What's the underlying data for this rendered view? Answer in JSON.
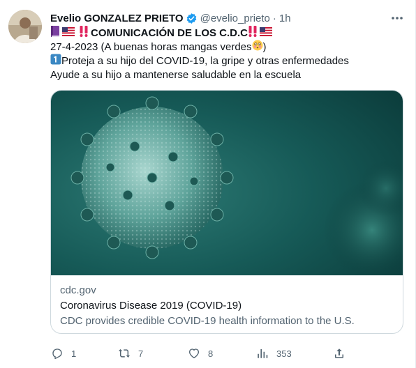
{
  "tweet": {
    "author_name": "Evelio GONZALEZ PRIETO",
    "author_handle": "@evelio_prieto",
    "separator": "·",
    "time": "1h",
    "lines": {
      "headline": "COMUNICACIÓN DE LOS C.D.C",
      "date_note": "27-4-2023 (A buenas horas mangas verdes",
      "date_close": ")",
      "item_one": "Proteja a su hijo del COVID-19, la gripe y otras enfermedades",
      "item_two": "Ayude a su hijo a mantenerse saludable en la escuela"
    },
    "emoji": {
      "book": "purple-book-icon",
      "flag": "us-flag-icon",
      "alert": "double-exclamation-icon",
      "face": "flushed-face-icon",
      "keycap": "keycap-1-icon"
    }
  },
  "card": {
    "image": "coronavirus-illustration",
    "domain": "cdc.gov",
    "title": "Coronavirus Disease 2019 (COVID-19)",
    "description": "CDC provides credible COVID-19 health information to the U.S."
  },
  "actions": {
    "reply_count": "1",
    "retweet_count": "7",
    "like_count": "8",
    "views_count": "353"
  },
  "colors": {
    "text": "#0f1419",
    "secondary": "#536471",
    "verified": "#1d9bf0",
    "border": "#cfd9de",
    "alert_red": "#e0245e"
  }
}
